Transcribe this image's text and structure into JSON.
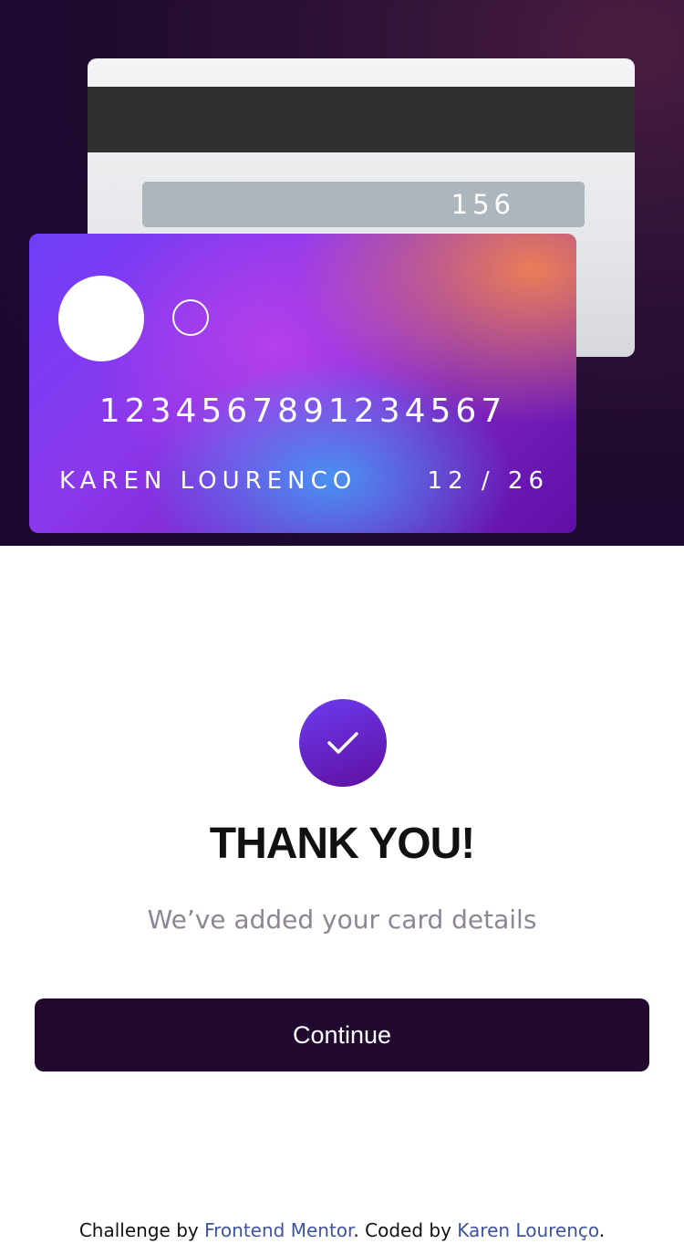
{
  "card_back": {
    "cvc": "156"
  },
  "card_front": {
    "number": "1234567891234567",
    "name": "KAREN LOURENCO",
    "expiry": "12 / 26"
  },
  "success": {
    "icon": "check-icon",
    "title": "THANK YOU!",
    "message": "We’ve added your card details",
    "button_label": "Continue"
  },
  "footer": {
    "prefix": "Challenge by ",
    "link1_text": "Frontend Mentor",
    "middle": ". Coded by ",
    "link2_text": "Karen Lourenço",
    "suffix": "."
  },
  "colors": {
    "hero_bg": "#1c0730",
    "button_bg": "#21092f",
    "link": "#3e52a3",
    "subtitle": "#8e8594"
  }
}
